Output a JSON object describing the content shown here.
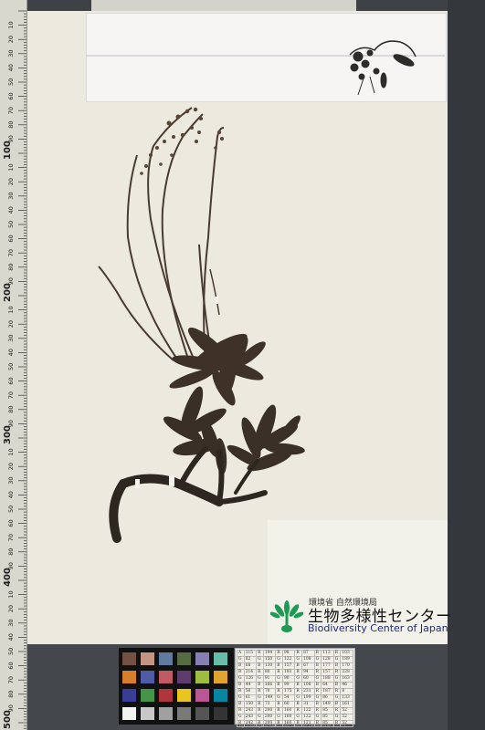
{
  "ruler": {
    "big_labels": [
      "100",
      "200",
      "300",
      "400",
      "500"
    ],
    "minor_labels": [
      "10",
      "20",
      "30",
      "40",
      "50",
      "60",
      "70",
      "80",
      "90"
    ]
  },
  "label": {
    "ministry_jp": "環境省 自然環境局",
    "center_jp": "生物多様性センター",
    "center_en": "Biodiversity Center of Japan",
    "logo_icon": "plant-sprout-icon",
    "logo_color": "#1e9a54"
  },
  "color_chart": {
    "swatches": [
      "#735244",
      "#c29682",
      "#627a9d",
      "#576c43",
      "#8580b1",
      "#67bdaa",
      "#d67e2c",
      "#505ba6",
      "#c15a63",
      "#5e3c6c",
      "#9dbc40",
      "#e0a32e",
      "#383d96",
      "#469449",
      "#af363c",
      "#e7c71f",
      "#bb5695",
      "#0885a1",
      "#f3f3f2",
      "#c8c8c8",
      "#a0a0a0",
      "#7a7a79",
      "#555555",
      "#343434"
    ]
  },
  "gray_table": {
    "rows": [
      [
        "A",
        "115",
        "R",
        "194",
        "R",
        "98",
        "R",
        "87",
        "R",
        "113",
        "R",
        "103"
      ],
      [
        "G",
        "82",
        "G",
        "150",
        "G",
        "122",
        "G",
        "108",
        "G",
        "128",
        "G",
        "189"
      ],
      [
        "B",
        "68",
        "B",
        "130",
        "B",
        "157",
        "B",
        "67",
        "B",
        "177",
        "B",
        "170"
      ],
      [
        "R",
        "214",
        "R",
        "80",
        "R",
        "193",
        "R",
        "94",
        "R",
        "157",
        "R",
        "228"
      ],
      [
        "G",
        "126",
        "G",
        "91",
        "G",
        "90",
        "G",
        "60",
        "G",
        "188",
        "G",
        "163"
      ],
      [
        "B",
        "44",
        "B",
        "166",
        "B",
        "99",
        "B",
        "108",
        "B",
        "64",
        "B",
        "46"
      ],
      [
        "R",
        "56",
        "R",
        "70",
        "R",
        "175",
        "R",
        "231",
        "R",
        "187",
        "R",
        "8"
      ],
      [
        "G",
        "61",
        "G",
        "149",
        "G",
        "54",
        "G",
        "199",
        "G",
        "86",
        "G",
        "133"
      ],
      [
        "B",
        "150",
        "B",
        "73",
        "B",
        "60",
        "B",
        "31",
        "B",
        "149",
        "B",
        "161"
      ],
      [
        "R",
        "243",
        "R",
        "200",
        "R",
        "160",
        "R",
        "122",
        "R",
        "85",
        "R",
        "52"
      ],
      [
        "G",
        "243",
        "G",
        "200",
        "G",
        "160",
        "G",
        "122",
        "G",
        "85",
        "G",
        "52"
      ],
      [
        "B",
        "242",
        "B",
        "200",
        "B",
        "160",
        "B",
        "121",
        "B",
        "85",
        "B",
        "52"
      ]
    ]
  },
  "chart_caption": "by: GretagMacbeth color checker (Illuminant C / 2°)"
}
